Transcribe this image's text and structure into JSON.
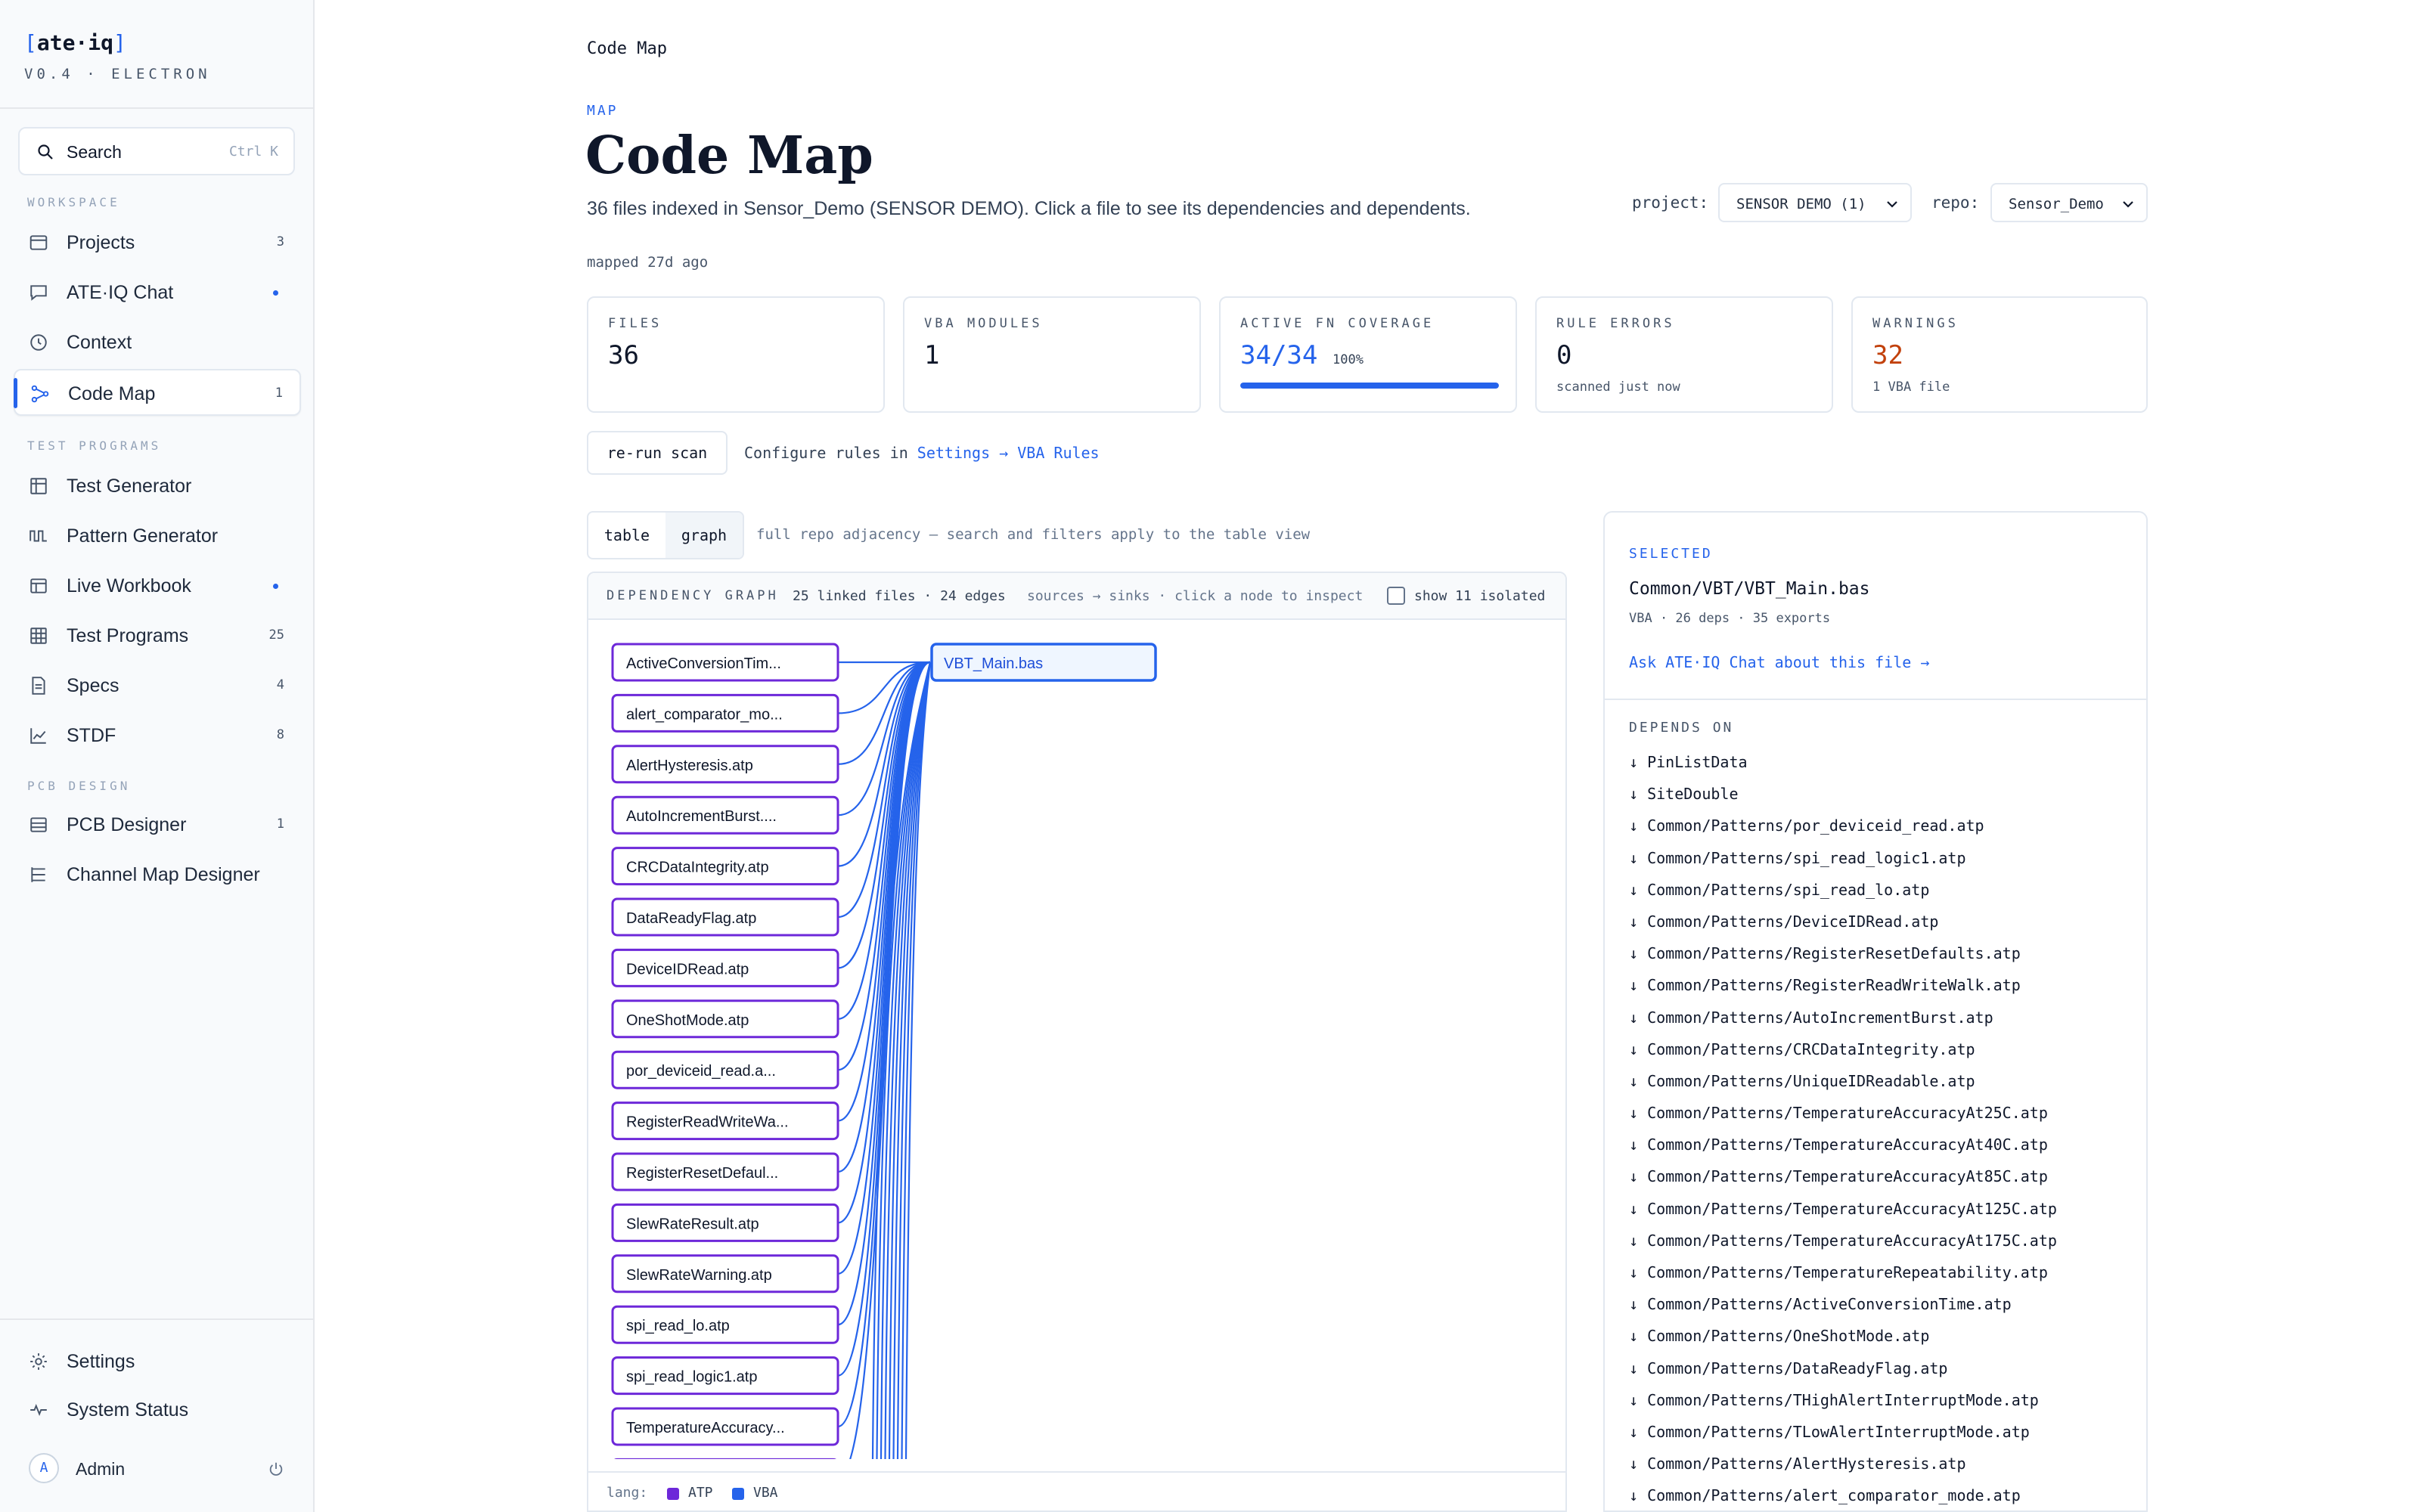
{
  "brand": {
    "logo_open": "[",
    "logo_name": "ate·iq",
    "logo_close": "]",
    "version": "V0.4 · ELECTRON"
  },
  "search": {
    "label": "Search",
    "shortcut": "Ctrl K"
  },
  "sidebar": {
    "section_workspace": "WORKSPACE",
    "section_test_programs": "TEST PROGRAMS",
    "section_pcb": "PCB DESIGN",
    "items": [
      {
        "label": "Projects",
        "badge": "3",
        "icon": "folder-icon"
      },
      {
        "label": "ATE·IQ Chat",
        "badge": "",
        "icon": "chat-icon",
        "dot": true
      },
      {
        "label": "Context",
        "badge": "",
        "icon": "clock-icon"
      },
      {
        "label": "Code Map",
        "badge": "1",
        "icon": "graph-icon",
        "active": true
      },
      {
        "label": "Test Generator",
        "badge": "",
        "icon": "generator-icon"
      },
      {
        "label": "Pattern Generator",
        "badge": "",
        "icon": "waveform-icon"
      },
      {
        "label": "Live Workbook",
        "badge": "",
        "icon": "workbook-icon",
        "dot": true
      },
      {
        "label": "Test Programs",
        "badge": "25",
        "icon": "grid-icon"
      },
      {
        "label": "Specs",
        "badge": "4",
        "icon": "document-icon"
      },
      {
        "label": "STDF",
        "badge": "8",
        "icon": "chart-icon"
      },
      {
        "label": "PCB Designer",
        "badge": "1",
        "icon": "board-icon"
      },
      {
        "label": "Channel Map Designer",
        "badge": "",
        "icon": "channels-icon"
      }
    ],
    "bottom": {
      "settings": "Settings",
      "status": "System Status",
      "avatar": "A",
      "user": "Admin"
    }
  },
  "header": {
    "breadcrumb": "Code Map",
    "eyebrow": "MAP",
    "title": "Code Map",
    "subtitle": "36 files indexed in Sensor_Demo (SENSOR DEMO). Click a file to see its dependencies and dependents.",
    "mapped": "mapped 27d ago",
    "project_label": "project:",
    "project_value": "SENSOR DEMO (1)",
    "repo_label": "repo:",
    "repo_value": "Sensor_Demo"
  },
  "stats": {
    "files": {
      "label": "FILES",
      "value": "36"
    },
    "vba": {
      "label": "VBA MODULES",
      "value": "1"
    },
    "coverage": {
      "label": "ACTIVE FN COVERAGE",
      "value": "34/34",
      "pct": "100%",
      "fraction": 1.0
    },
    "errors": {
      "label": "RULE ERRORS",
      "value": "0",
      "sub": "scanned just now"
    },
    "warnings": {
      "label": "WARNINGS",
      "value": "32",
      "sub": "1 VBA file"
    }
  },
  "actions": {
    "rerun": "re-run scan",
    "cfg_prefix": "Configure rules in ",
    "cfg_link": "Settings → VBA Rules"
  },
  "view": {
    "table": "table",
    "graph": "graph",
    "hint": "full repo adjacency — search and filters apply to the table view"
  },
  "graph": {
    "header": "DEPENDENCY GRAPH",
    "stats": "25 linked files · 24 edges",
    "hint": "sources → sinks · click a node to inspect",
    "isolated": "show 11 isolated",
    "target": "VBT_Main.bas",
    "sources": [
      "ActiveConversionTim...",
      "alert_comparator_mo...",
      "AlertHysteresis.atp",
      "AutoIncrementBurst....",
      "CRCDataIntegrity.atp",
      "DataReadyFlag.atp",
      "DeviceIDRead.atp",
      "OneShotMode.atp",
      "por_deviceid_read.a...",
      "RegisterReadWriteWa...",
      "RegisterResetDefaul...",
      "SlewRateResult.atp",
      "SlewRateWarning.atp",
      "spi_read_lo.atp",
      "spi_read_logic1.atp",
      "TemperatureAccuracy...",
      ""
    ],
    "legend_label": "lang:",
    "legend": [
      {
        "name": "ATP",
        "color": "#6d28d9"
      },
      {
        "name": "VBA",
        "color": "#2563eb"
      }
    ]
  },
  "selected": {
    "label": "SELECTED",
    "path": "Common/VBT/VBT_Main.bas",
    "meta": "VBA · 26 deps · 35 exports",
    "ask": "Ask ATE·IQ Chat about this file →",
    "depends_label": "DEPENDS ON",
    "depends": [
      "↓ PinListData",
      "↓ SiteDouble",
      "↓ Common/Patterns/por_deviceid_read.atp",
      "↓ Common/Patterns/spi_read_logic1.atp",
      "↓ Common/Patterns/spi_read_lo.atp",
      "↓ Common/Patterns/DeviceIDRead.atp",
      "↓ Common/Patterns/RegisterResetDefaults.atp",
      "↓ Common/Patterns/RegisterReadWriteWalk.atp",
      "↓ Common/Patterns/AutoIncrementBurst.atp",
      "↓ Common/Patterns/CRCDataIntegrity.atp",
      "↓ Common/Patterns/UniqueIDReadable.atp",
      "↓ Common/Patterns/TemperatureAccuracyAt25C.atp",
      "↓ Common/Patterns/TemperatureAccuracyAt40C.atp",
      "↓ Common/Patterns/TemperatureAccuracyAt85C.atp",
      "↓ Common/Patterns/TemperatureAccuracyAt125C.atp",
      "↓ Common/Patterns/TemperatureAccuracyAt175C.atp",
      "↓ Common/Patterns/TemperatureRepeatability.atp",
      "↓ Common/Patterns/ActiveConversionTime.atp",
      "↓ Common/Patterns/OneShotMode.atp",
      "↓ Common/Patterns/DataReadyFlag.atp",
      "↓ Common/Patterns/THighAlertInterruptMode.atp",
      "↓ Common/Patterns/TLowAlertInterruptMode.atp",
      "↓ Common/Patterns/AlertHysteresis.atp",
      "↓ Common/Patterns/alert_comparator_mode.atp"
    ]
  }
}
